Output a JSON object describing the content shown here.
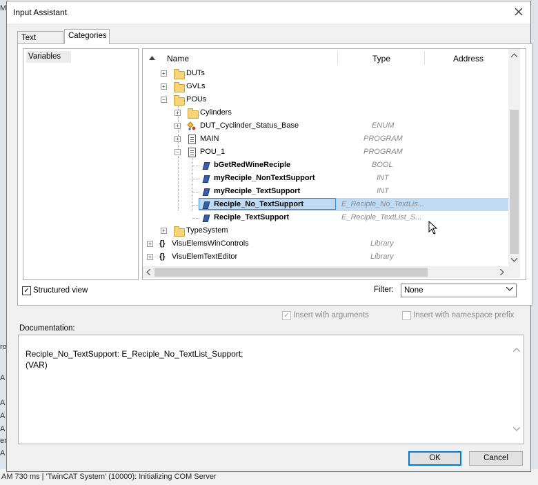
{
  "dialog": {
    "title": "Input Assistant"
  },
  "tabs": [
    "Text search",
    "Categories"
  ],
  "categories": [
    "Variables"
  ],
  "tree": {
    "columns": {
      "name": "Name",
      "type": "Type",
      "address": "Address"
    },
    "rows": [
      {
        "name": "DUTs",
        "type": ""
      },
      {
        "name": "GVLs",
        "type": ""
      },
      {
        "name": "POUs",
        "type": ""
      },
      {
        "name": "Cylinders",
        "type": ""
      },
      {
        "name": "DUT_Cyclinder_Status_Base",
        "type": "ENUM"
      },
      {
        "name": "MAIN",
        "type": "PROGRAM"
      },
      {
        "name": "POU_1",
        "type": "PROGRAM"
      },
      {
        "name": "bGetRedWineReciple",
        "type": "BOOL"
      },
      {
        "name": "myReciple_NonTextSupport",
        "type": "INT"
      },
      {
        "name": "myReciple_TextSupport",
        "type": "INT"
      },
      {
        "name": "Reciple_No_TextSupport",
        "type": "E_Reciple_No_TextLis..."
      },
      {
        "name": "Reciple_TextSupport",
        "type": "E_Reciple_TextList_S..."
      },
      {
        "name": "TypeSystem",
        "type": ""
      },
      {
        "name": "VisuElemsWinControls",
        "type": "Library"
      },
      {
        "name": "VisuElemTextEditor",
        "type": "Library"
      }
    ]
  },
  "structured_view": {
    "label": "Structured view",
    "checked": true
  },
  "filter": {
    "label": "Filter:",
    "value": "None"
  },
  "options": {
    "insert_with_arguments": "Insert with arguments",
    "insert_with_namespace_prefix": "Insert with namespace prefix"
  },
  "documentation": {
    "label": "Documentation:",
    "line1": "Reciple_No_TextSupport: E_Reciple_No_TextList_Support;",
    "line2": "(VAR)"
  },
  "buttons": {
    "ok": "OK",
    "cancel": "Cancel"
  },
  "background": {
    "status": "AM 730 ms | 'TwinCAT System' (10000): Initializing COM Server",
    "frag_top": "Ma",
    "frag_ro": "ro",
    "frag_a": "A",
    "frag_er": "er"
  }
}
